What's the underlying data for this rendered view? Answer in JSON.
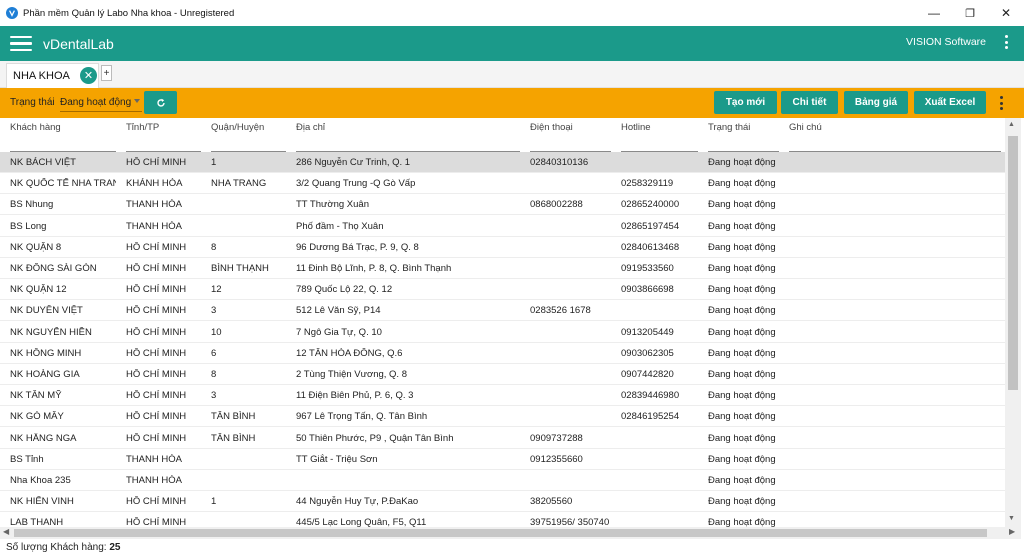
{
  "window": {
    "title": "Phần mềm Quản lý Labo Nha khoa - Unregistered",
    "minimize": "—",
    "restore": "❐",
    "close": "✕"
  },
  "appbar": {
    "brand": "vDentalLab",
    "company": "VISION Software"
  },
  "tabs": [
    {
      "label": "NHA KHOA",
      "close": "✕"
    }
  ],
  "tab_add": "+",
  "toolbar": {
    "status_label": "Trạng thái",
    "status_value": "Đang hoạt động",
    "buttons": {
      "create": "Tạo mới",
      "detail": "Chi tiết",
      "price": "Bảng giá",
      "export": "Xuất Excel"
    }
  },
  "table": {
    "columns": [
      "Khách hàng",
      "Tỉnh/TP",
      "Quận/Huyện",
      "Địa chỉ",
      "Điện thoại",
      "Hotline",
      "Trạng thái",
      "Ghi chú"
    ],
    "rows": [
      [
        "NK BÁCH VIỆT",
        "HỒ CHÍ MINH",
        "1",
        "286 Nguyễn Cư Trinh, Q. 1",
        "02840310136",
        "",
        "Đang hoạt động",
        ""
      ],
      [
        "NK QUỐC TẾ NHA TRANG",
        "KHÁNH HÒA",
        "NHA TRANG",
        "3/2 Quang Trung -Q Gò Vấp",
        "",
        "0258329119",
        "Đang hoạt động",
        ""
      ],
      [
        "BS Nhung",
        "THANH HÓA",
        "",
        "TT Thường Xuân",
        "0868002288",
        "02865240000",
        "Đang hoạt động",
        ""
      ],
      [
        "BS Long",
        "THANH HÓA",
        "",
        "Phố đầm - Thọ Xuân",
        "",
        "02865197454",
        "Đang hoạt động",
        ""
      ],
      [
        "NK QUẬN 8",
        "HỒ CHÍ MINH",
        "8",
        "96 Dương Bá Trạc, P. 9, Q. 8",
        "",
        "02840613468",
        "Đang hoạt động",
        ""
      ],
      [
        "NK ĐÔNG SÀI GÒN",
        "HỒ CHÍ MINH",
        "BÌNH THẠNH",
        "11 Đinh Bộ Lĩnh, P. 8, Q. Bình Thạnh",
        "",
        "0919533560",
        "Đang hoạt động",
        ""
      ],
      [
        "NK QUẬN 12",
        "HỒ CHÍ MINH",
        "12",
        "789 Quốc Lộ 22, Q. 12",
        "",
        "0903866698",
        "Đang hoạt động",
        ""
      ],
      [
        "NK DUYÊN VIỆT",
        "HỒ CHÍ MINH",
        "3",
        "512 Lê Văn Sỹ, P14",
        "0283526 1678",
        "",
        "Đang hoạt động",
        ""
      ],
      [
        "NK NGUYỄN HIỀN",
        "HỒ CHÍ MINH",
        "10",
        "7 Ngô Gia Tự, Q. 10",
        "",
        "0913205449",
        "Đang hoạt động",
        ""
      ],
      [
        "NK HỒNG MINH",
        "HỒ CHÍ MINH",
        "6",
        "12 TÂN HÒA ĐÔNG, Q.6",
        "",
        "0903062305",
        "Đang hoạt động",
        ""
      ],
      [
        "NK HOÀNG GIA",
        "HỒ CHÍ MINH",
        "8",
        "2 Tùng Thiện Vương, Q. 8",
        "",
        "0907442820",
        "Đang hoạt động",
        ""
      ],
      [
        "NK TÂN MỸ",
        "HỒ CHÍ MINH",
        "3",
        "11 Điện Biên Phủ, P. 6, Q. 3",
        "",
        "02839446980",
        "Đang hoạt động",
        ""
      ],
      [
        "NK GÒ MÂY",
        "HỒ CHÍ MINH",
        "TÂN BÌNH",
        "967 Lê Trọng Tấn, Q. Tân Bình",
        "",
        "02846195254",
        "Đang hoạt động",
        ""
      ],
      [
        "NK HẰNG NGA",
        "HỒ CHÍ MINH",
        "TÂN BÌNH",
        "50 Thiên Phước, P9 , Quận Tân Bình",
        "0909737288",
        "",
        "Đang hoạt động",
        ""
      ],
      [
        "BS Tỉnh",
        "THANH HÓA",
        "",
        "TT Giắt - Triệu Sơn",
        "0912355660",
        "",
        "Đang hoạt động",
        ""
      ],
      [
        "Nha Khoa 235",
        "THANH HÓA",
        "",
        "",
        "",
        "",
        "Đang hoạt động",
        ""
      ],
      [
        "NK HIỂN VINH",
        "HỒ CHÍ MINH",
        "1",
        "44 Nguyễn Huy Tự,  P.ĐaKao",
        "38205560",
        "",
        "Đang hoạt động",
        ""
      ],
      [
        "LAB THANH",
        "HỒ CHÍ MINH",
        "",
        "445/5 Lạc Long Quân, F5, Q11",
        "39751956/ 350740",
        "",
        "Đang hoạt động",
        ""
      ]
    ]
  },
  "footer": {
    "count_label": "Số lượng Khách hàng:",
    "count": "25"
  },
  "colors": {
    "primary": "#1b9a8a",
    "toolbar": "#f5a300",
    "selected_row": "#dcdcdc"
  }
}
